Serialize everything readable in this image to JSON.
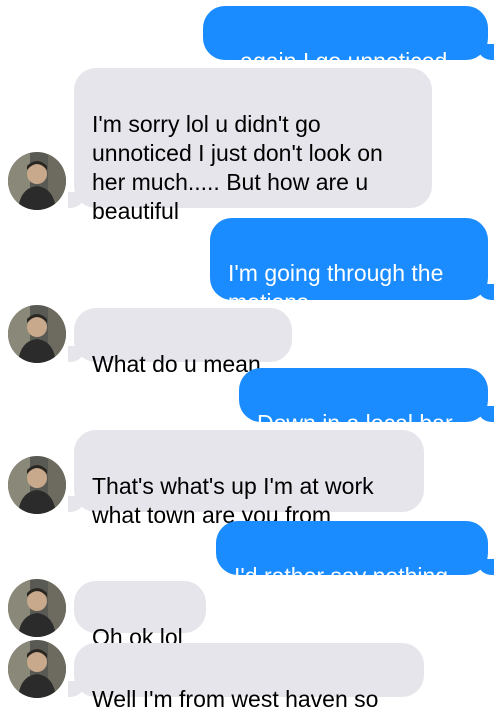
{
  "messages": [
    {
      "from": "me",
      "text": "...again I go unnoticed"
    },
    {
      "from": "contact",
      "text": "I'm sorry lol u didn't go unnoticed I just don't look on her much..... But how are u beautiful"
    },
    {
      "from": "me",
      "text": "I'm going through the motions"
    },
    {
      "from": "contact",
      "text": "What do u mean"
    },
    {
      "from": "me",
      "text": "Down in a local bar"
    },
    {
      "from": "contact",
      "text": "That's what's up I'm at work what town are you from"
    },
    {
      "from": "me",
      "text": "I'd rather say nothing"
    },
    {
      "from": "contact",
      "text": "Oh ok lol"
    },
    {
      "from": "contact",
      "text": "Well I'm from west haven so"
    }
  ],
  "colors": {
    "sent_bubble": "#1a8cff",
    "received_bubble": "#e6e5eb"
  },
  "icons": {
    "contact_avatar": "contact-avatar-photo"
  }
}
